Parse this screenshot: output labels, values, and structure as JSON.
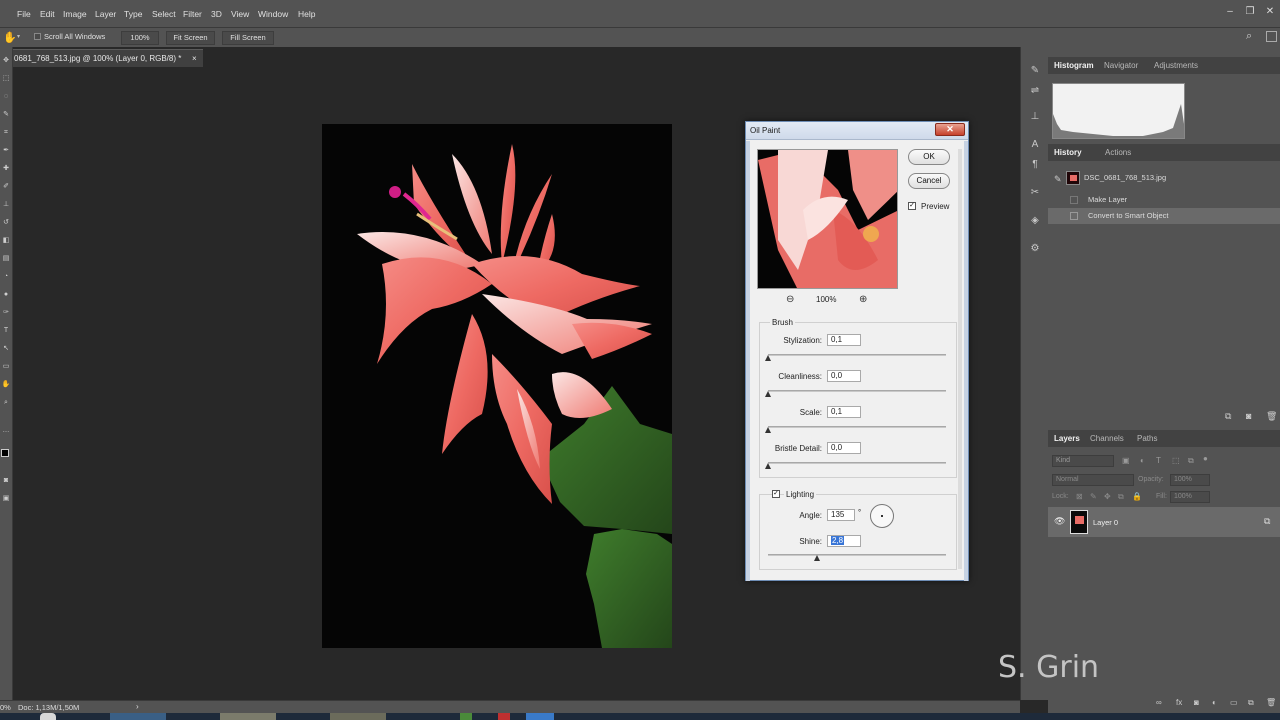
{
  "menubar": {
    "items": [
      "File",
      "Edit",
      "Image",
      "Layer",
      "Type",
      "Select",
      "Filter",
      "3D",
      "View",
      "Window",
      "Help"
    ],
    "window_controls": [
      "–",
      "❐",
      "✕"
    ]
  },
  "options": {
    "scroll_all_label": "Scroll All Windows",
    "zoom_value": "100%",
    "fit_screen": "Fit Screen",
    "fill_screen": "Fill Screen"
  },
  "document": {
    "tab_title": "0681_768_513.jpg @ 100% (Layer 0, RGB/8) *",
    "tab_close": "×"
  },
  "status": {
    "zoom": "0%",
    "doc": "Doc: 1,13M/1,50M",
    "arrow": "›"
  },
  "dialog": {
    "title": "Oil Paint",
    "close": "✕",
    "ok": "OK",
    "cancel": "Cancel",
    "preview_label": "Preview",
    "preview_zoom": "100%",
    "brush_heading": "Brush",
    "stylization_label": "Stylization:",
    "stylization_value": "0,1",
    "cleanliness_label": "Cleanliness:",
    "cleanliness_value": "0,0",
    "scale_label": "Scale:",
    "scale_value": "0,1",
    "bristle_label": "Bristle Detail:",
    "bristle_value": "0,0",
    "lighting_label": "Lighting",
    "angle_label": "Angle:",
    "angle_value": "135",
    "angle_unit": "°",
    "shine_label": "Shine:",
    "shine_value": "2,8"
  },
  "panels": {
    "histogram_tabs": [
      "Histogram",
      "Navigator",
      "Adjustments"
    ],
    "history_tabs": [
      "History",
      "Actions"
    ],
    "history_snapshot": "DSC_0681_768_513.jpg",
    "history_items": [
      "Make Layer",
      "Convert to Smart Object"
    ],
    "layers_tabs": [
      "Layers",
      "Channels",
      "Paths"
    ],
    "kind_filter": "Kind",
    "blend_mode": "Normal",
    "opacity_label": "Opacity:",
    "opacity_value": "100%",
    "lock_label": "Lock:",
    "fill_label": "Fill:",
    "fill_value": "100%",
    "layer_name": "Layer 0"
  },
  "watermark": "S. Grin"
}
